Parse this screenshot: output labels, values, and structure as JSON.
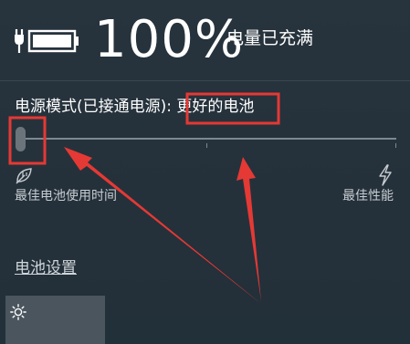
{
  "battery": {
    "percent": "100%",
    "status": "电量已充满",
    "icon": "battery-full-charging-icon"
  },
  "power_mode": {
    "label": "电源模式(已接通电源): ",
    "value": "更好的电池",
    "slider_level": 0,
    "left_label": "最佳电池使用时间",
    "right_label": "最佳性能",
    "left_icon": "leaf-icon",
    "right_icon": "lightning-icon"
  },
  "settings": {
    "link_label": "电池设置"
  },
  "tile": {
    "icon": "brightness-icon"
  },
  "colors": {
    "background": "#24313b",
    "annotation": "#e53935",
    "slider_track": "#7e8891",
    "slider_thumb": "#6c747b",
    "tile": "#4a555e"
  }
}
